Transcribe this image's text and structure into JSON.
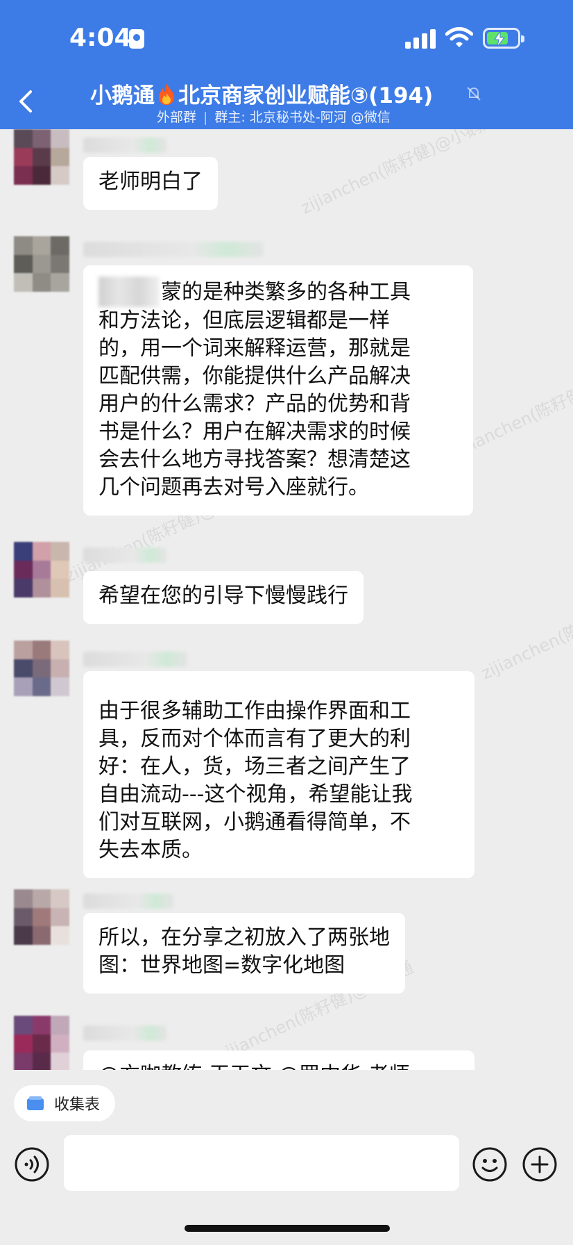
{
  "status_bar": {
    "time": "4:04"
  },
  "header": {
    "title_part1": "小鹅通",
    "title_part2": "北京商家创业赋能③(194)",
    "subtitle_tag": "外部群",
    "subtitle_owner": "群主: 北京秘书处-阿河 @微信"
  },
  "messages": [
    {
      "text": "老师明白了"
    },
    {
      "text": "蒙的是种类繁多的各种工具\n和方法论，但底层逻辑都是一样\n的，用一个词来解释运营，那就是\n匹配供需，你能提供什么产品解决\n用户的什么需求？产品的优势和背\n书是什么？用户在解决需求的时候\n会去什么地方寻找答案？想清楚这\n几个问题再去对号入座就行。"
    },
    {
      "text": "希望在您的引导下慢慢践行"
    },
    {
      "text": "由于很多辅助工作由操作界面和工\n具，反而对个体而言有了更大的利\n好：在人，货，场三者之间产生了\n自由流动---这个视角，希望能让我\n们对互联网，小鹅通看得简单，不\n失去本质。"
    },
    {
      "text": "所以，在分享之初放入了两张地\n图：世界地图=数字化地图"
    },
    {
      "text": "@方咖教练 王天文 @罗中华 老师"
    }
  ],
  "watermark": "zijianchen(陈籽健)@小鹅通",
  "bottom": {
    "collect_chip_label": "收集表",
    "input_placeholder": ""
  },
  "colors": {
    "header_bg": "#3d7be6",
    "chat_bg": "#ededed",
    "bubble_bg": "#ffffff",
    "battery_green": "#5ee26a"
  }
}
